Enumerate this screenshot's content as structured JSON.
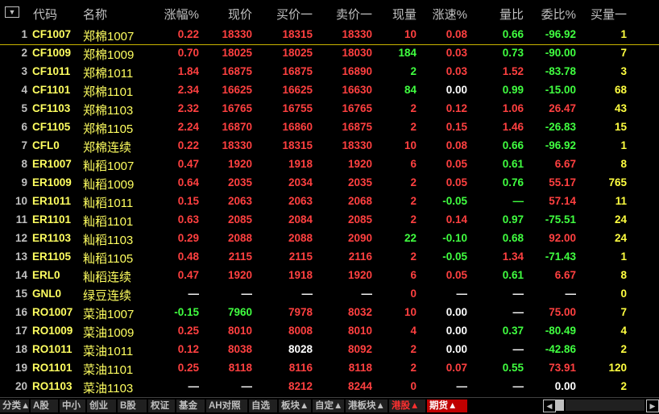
{
  "menu_icon": "dropdown-icon",
  "headers": [
    "代码",
    "名称",
    "涨幅%",
    "现价",
    "买价一",
    "卖价一",
    "现量",
    "涨速%",
    "量比",
    "委比%",
    "买量一"
  ],
  "rows": [
    {
      "idx": "1",
      "code": "CF1007",
      "name": "郑棉1007",
      "chg": "0.22",
      "price": "18330",
      "bid": "18315",
      "ask": "18330",
      "vol": "10",
      "speed": "0.08",
      "vr": "0.66",
      "wb": "-96.92",
      "bidvol": "1",
      "c": [
        "red",
        "red",
        "red",
        "red",
        "red",
        "red",
        "green",
        "green",
        "yellow"
      ]
    },
    {
      "idx": "2",
      "code": "CF1009",
      "name": "郑棉1009",
      "chg": "0.70",
      "price": "18025",
      "bid": "18025",
      "ask": "18030",
      "vol": "184",
      "speed": "0.03",
      "vr": "0.73",
      "wb": "-90.00",
      "bidvol": "7",
      "c": [
        "red",
        "red",
        "red",
        "red",
        "green",
        "red",
        "green",
        "green",
        "yellow"
      ]
    },
    {
      "idx": "3",
      "code": "CF1011",
      "name": "郑棉1011",
      "chg": "1.84",
      "price": "16875",
      "bid": "16875",
      "ask": "16890",
      "vol": "2",
      "speed": "0.03",
      "vr": "1.52",
      "wb": "-83.78",
      "bidvol": "3",
      "c": [
        "red",
        "red",
        "red",
        "red",
        "green",
        "red",
        "red",
        "green",
        "yellow"
      ]
    },
    {
      "idx": "4",
      "code": "CF1101",
      "name": "郑棉1101",
      "chg": "2.34",
      "price": "16625",
      "bid": "16625",
      "ask": "16630",
      "vol": "84",
      "speed": "0.00",
      "vr": "0.99",
      "wb": "-15.00",
      "bidvol": "68",
      "c": [
        "red",
        "red",
        "red",
        "red",
        "green",
        "white",
        "green",
        "green",
        "yellow"
      ]
    },
    {
      "idx": "5",
      "code": "CF1103",
      "name": "郑棉1103",
      "chg": "2.32",
      "price": "16765",
      "bid": "16755",
      "ask": "16765",
      "vol": "2",
      "speed": "0.12",
      "vr": "1.06",
      "wb": "26.47",
      "bidvol": "43",
      "c": [
        "red",
        "red",
        "red",
        "red",
        "red",
        "red",
        "red",
        "red",
        "yellow"
      ]
    },
    {
      "idx": "6",
      "code": "CF1105",
      "name": "郑棉1105",
      "chg": "2.24",
      "price": "16870",
      "bid": "16860",
      "ask": "16875",
      "vol": "2",
      "speed": "0.15",
      "vr": "1.46",
      "wb": "-26.83",
      "bidvol": "15",
      "c": [
        "red",
        "red",
        "red",
        "red",
        "red",
        "red",
        "red",
        "green",
        "yellow"
      ]
    },
    {
      "idx": "7",
      "code": "CFL0",
      "name": "郑棉连续",
      "chg": "0.22",
      "price": "18330",
      "bid": "18315",
      "ask": "18330",
      "vol": "10",
      "speed": "0.08",
      "vr": "0.66",
      "wb": "-96.92",
      "bidvol": "1",
      "c": [
        "red",
        "red",
        "red",
        "red",
        "red",
        "red",
        "green",
        "green",
        "yellow"
      ]
    },
    {
      "idx": "8",
      "code": "ER1007",
      "name": "籼稻1007",
      "chg": "0.47",
      "price": "1920",
      "bid": "1918",
      "ask": "1920",
      "vol": "6",
      "speed": "0.05",
      "vr": "0.61",
      "wb": "6.67",
      "bidvol": "8",
      "c": [
        "red",
        "red",
        "red",
        "red",
        "red",
        "red",
        "green",
        "red",
        "yellow"
      ]
    },
    {
      "idx": "9",
      "code": "ER1009",
      "name": "籼稻1009",
      "chg": "0.64",
      "price": "2035",
      "bid": "2034",
      "ask": "2035",
      "vol": "2",
      "speed": "0.05",
      "vr": "0.76",
      "wb": "55.17",
      "bidvol": "765",
      "c": [
        "red",
        "red",
        "red",
        "red",
        "red",
        "red",
        "green",
        "red",
        "yellow"
      ]
    },
    {
      "idx": "10",
      "code": "ER1011",
      "name": "籼稻1011",
      "chg": "0.15",
      "price": "2063",
      "bid": "2063",
      "ask": "2068",
      "vol": "2",
      "speed": "-0.05",
      "vr": "—",
      "wb": "57.14",
      "bidvol": "11",
      "c": [
        "red",
        "red",
        "red",
        "red",
        "red",
        "green",
        "green",
        "red",
        "yellow"
      ]
    },
    {
      "idx": "11",
      "code": "ER1101",
      "name": "籼稻1101",
      "chg": "0.63",
      "price": "2085",
      "bid": "2084",
      "ask": "2085",
      "vol": "2",
      "speed": "0.14",
      "vr": "0.97",
      "wb": "-75.51",
      "bidvol": "24",
      "c": [
        "red",
        "red",
        "red",
        "red",
        "red",
        "red",
        "green",
        "green",
        "yellow"
      ]
    },
    {
      "idx": "12",
      "code": "ER1103",
      "name": "籼稻1103",
      "chg": "0.29",
      "price": "2088",
      "bid": "2088",
      "ask": "2090",
      "vol": "22",
      "speed": "-0.10",
      "vr": "0.68",
      "wb": "92.00",
      "bidvol": "24",
      "c": [
        "red",
        "red",
        "red",
        "red",
        "green",
        "green",
        "green",
        "red",
        "yellow"
      ]
    },
    {
      "idx": "13",
      "code": "ER1105",
      "name": "籼稻1105",
      "chg": "0.48",
      "price": "2115",
      "bid": "2115",
      "ask": "2116",
      "vol": "2",
      "speed": "-0.05",
      "vr": "1.34",
      "wb": "-71.43",
      "bidvol": "1",
      "c": [
        "red",
        "red",
        "red",
        "red",
        "red",
        "green",
        "red",
        "green",
        "yellow"
      ]
    },
    {
      "idx": "14",
      "code": "ERL0",
      "name": "籼稻连续",
      "chg": "0.47",
      "price": "1920",
      "bid": "1918",
      "ask": "1920",
      "vol": "6",
      "speed": "0.05",
      "vr": "0.61",
      "wb": "6.67",
      "bidvol": "8",
      "c": [
        "red",
        "red",
        "red",
        "red",
        "red",
        "red",
        "green",
        "red",
        "yellow"
      ]
    },
    {
      "idx": "15",
      "code": "GNL0",
      "name": "绿豆连续",
      "chg": "—",
      "price": "—",
      "bid": "—",
      "ask": "—",
      "vol": "0",
      "speed": "—",
      "vr": "—",
      "wb": "—",
      "bidvol": "0",
      "c": [
        "white",
        "white",
        "white",
        "white",
        "red",
        "white",
        "white",
        "white",
        "yellow"
      ]
    },
    {
      "idx": "16",
      "code": "RO1007",
      "name": "菜油1007",
      "chg": "-0.15",
      "price": "7960",
      "bid": "7978",
      "ask": "8032",
      "vol": "10",
      "speed": "0.00",
      "vr": "—",
      "wb": "75.00",
      "bidvol": "7",
      "c": [
        "green",
        "green",
        "red",
        "red",
        "red",
        "white",
        "white",
        "red",
        "yellow"
      ]
    },
    {
      "idx": "17",
      "code": "RO1009",
      "name": "菜油1009",
      "chg": "0.25",
      "price": "8010",
      "bid": "8008",
      "ask": "8010",
      "vol": "4",
      "speed": "0.00",
      "vr": "0.37",
      "wb": "-80.49",
      "bidvol": "4",
      "c": [
        "red",
        "red",
        "red",
        "red",
        "red",
        "white",
        "green",
        "green",
        "yellow"
      ]
    },
    {
      "idx": "18",
      "code": "RO1011",
      "name": "菜油1011",
      "chg": "0.12",
      "price": "8038",
      "bid": "8028",
      "ask": "8092",
      "vol": "2",
      "speed": "0.00",
      "vr": "—",
      "wb": "-42.86",
      "bidvol": "2",
      "c": [
        "red",
        "red",
        "white",
        "red",
        "red",
        "white",
        "white",
        "green",
        "yellow"
      ]
    },
    {
      "idx": "19",
      "code": "RO1101",
      "name": "菜油1101",
      "chg": "0.25",
      "price": "8118",
      "bid": "8116",
      "ask": "8118",
      "vol": "2",
      "speed": "0.07",
      "vr": "0.55",
      "wb": "73.91",
      "bidvol": "120",
      "c": [
        "red",
        "red",
        "red",
        "red",
        "red",
        "red",
        "green",
        "red",
        "yellow"
      ]
    },
    {
      "idx": "20",
      "code": "RO1103",
      "name": "菜油1103",
      "chg": "—",
      "price": "—",
      "bid": "8212",
      "ask": "8244",
      "vol": "0",
      "speed": "—",
      "vr": "—",
      "wb": "0.00",
      "bidvol": "2",
      "c": [
        "white",
        "white",
        "red",
        "red",
        "red",
        "white",
        "white",
        "white",
        "yellow"
      ]
    }
  ],
  "tabs": [
    "分类▲",
    "A股",
    "中小",
    "创业",
    "B股",
    "权证",
    "基金",
    "AH对照",
    "自选",
    "板块▲",
    "自定▲",
    "港板块▲",
    "港股▲",
    "期货▲"
  ],
  "scroll_left": "◀",
  "scroll_right": "▶"
}
